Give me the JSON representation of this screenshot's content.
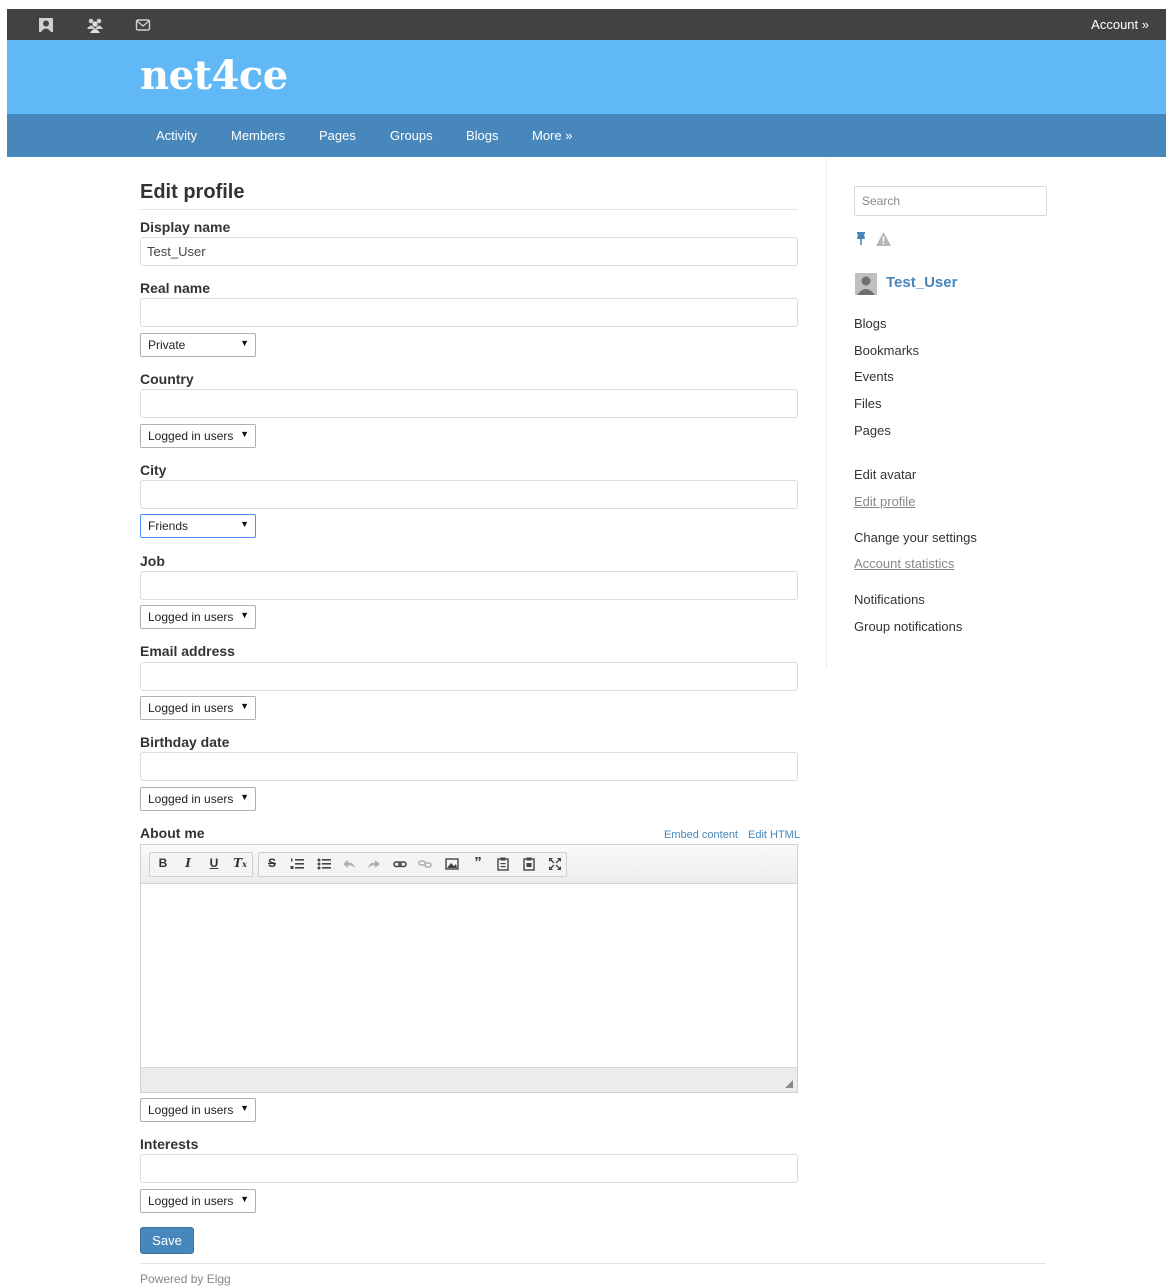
{
  "topbar": {
    "icons": [
      "profile-icon",
      "friends-icon",
      "messages-icon"
    ],
    "account_label": "Account »"
  },
  "header": {
    "logo": "net4ce"
  },
  "nav": {
    "items": [
      {
        "label": "Activity"
      },
      {
        "label": "Members"
      },
      {
        "label": "Pages"
      },
      {
        "label": "Groups"
      },
      {
        "label": "Blogs"
      },
      {
        "label": "More »"
      }
    ]
  },
  "form": {
    "title": "Edit profile",
    "display_name": {
      "label": "Display name",
      "value": "Test_User"
    },
    "real_name": {
      "label": "Real name",
      "value": "",
      "access": "Private"
    },
    "country": {
      "label": "Country",
      "value": "",
      "access": "Logged in users"
    },
    "city": {
      "label": "City",
      "value": "",
      "access": "Friends"
    },
    "job": {
      "label": "Job",
      "value": "",
      "access": "Logged in users"
    },
    "email": {
      "label": "Email address",
      "value": "",
      "access": "Logged in users"
    },
    "birthday": {
      "label": "Birthday date",
      "value": "",
      "access": "Logged in users"
    },
    "about": {
      "label": "About me",
      "embed_link": "Embed content",
      "html_link": "Edit HTML",
      "toolbar": [
        "B",
        "I",
        "U",
        "Tx",
        "S",
        "ordered-list",
        "bullet-list",
        "undo",
        "redo",
        "link",
        "unlink",
        "image",
        "quote",
        "paste-text",
        "paste-word",
        "maximize"
      ],
      "access": "Logged in users"
    },
    "interests": {
      "label": "Interests",
      "value": "",
      "access": "Logged in users"
    },
    "save_label": "Save"
  },
  "sidebar": {
    "search_placeholder": "Search",
    "user_name": "Test_User",
    "links_group1": [
      "Blogs",
      "Bookmarks",
      "Events",
      "Files",
      "Pages"
    ],
    "edit_avatar": "Edit avatar",
    "edit_profile": "Edit profile",
    "change_settings": "Change your settings",
    "account_statistics": "Account statistics",
    "notifications": "Notifications",
    "group_notifications": "Group notifications"
  },
  "footer": {
    "text": "Powered by Elgg"
  },
  "colors": {
    "header": "#60b8f7",
    "nav": "#4787bc",
    "topbar": "#424242",
    "accent": "#4787bc"
  }
}
